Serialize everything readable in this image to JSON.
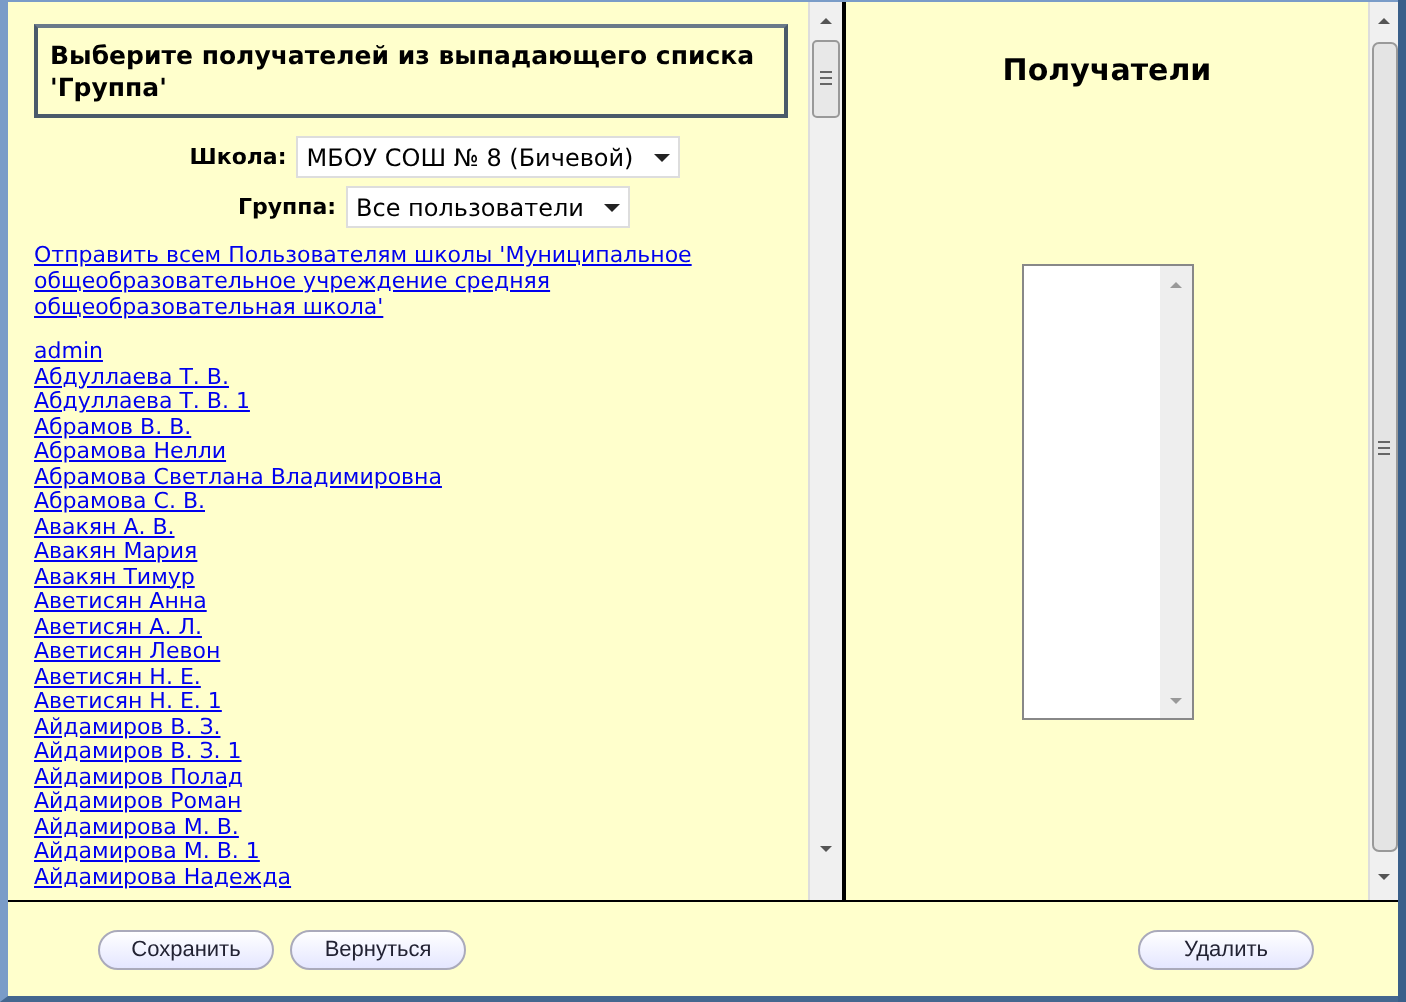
{
  "left_panel": {
    "heading": "Выберите получателей из выпадающего списка 'Группа'",
    "fields": [
      {
        "label": "Школа:",
        "value": "МБОУ СОШ № 8 (Бичевой)"
      },
      {
        "label": "Группа:",
        "value": "Все пользователи"
      }
    ],
    "send_all_link": "Отправить всем Пользователям школы 'Муниципальное общеобразовательное учреждение средняя общеобразовательная школа'",
    "users": [
      "admin",
      "Абдуллаева Т. В.",
      "Абдуллаева Т. В. 1",
      "Абрамов В. В.",
      "Абрамова Нелли",
      "Абрамова Светлана Владимировна",
      "Абрамова С. В.",
      "Авакян А. В.",
      "Авакян Мария",
      "Авакян Тимур",
      "Аветисян Анна",
      "Аветисян А. Л.",
      "Аветисян Левон",
      "Аветисян Н. Е.",
      "Аветисян Н. Е. 1",
      "Айдамиров В. З.",
      "Айдамиров В. З. 1",
      "Айдамиров Полад",
      "Айдамиров Роман",
      "Айдамирова М. В.",
      "Айдамирова М. В. 1",
      "Айдамирова Надежда"
    ]
  },
  "right_panel": {
    "heading": "Получатели"
  },
  "footer": {
    "left_buttons": [
      "Сохранить",
      "Вернуться"
    ],
    "right_buttons": [
      "Удалить"
    ]
  }
}
